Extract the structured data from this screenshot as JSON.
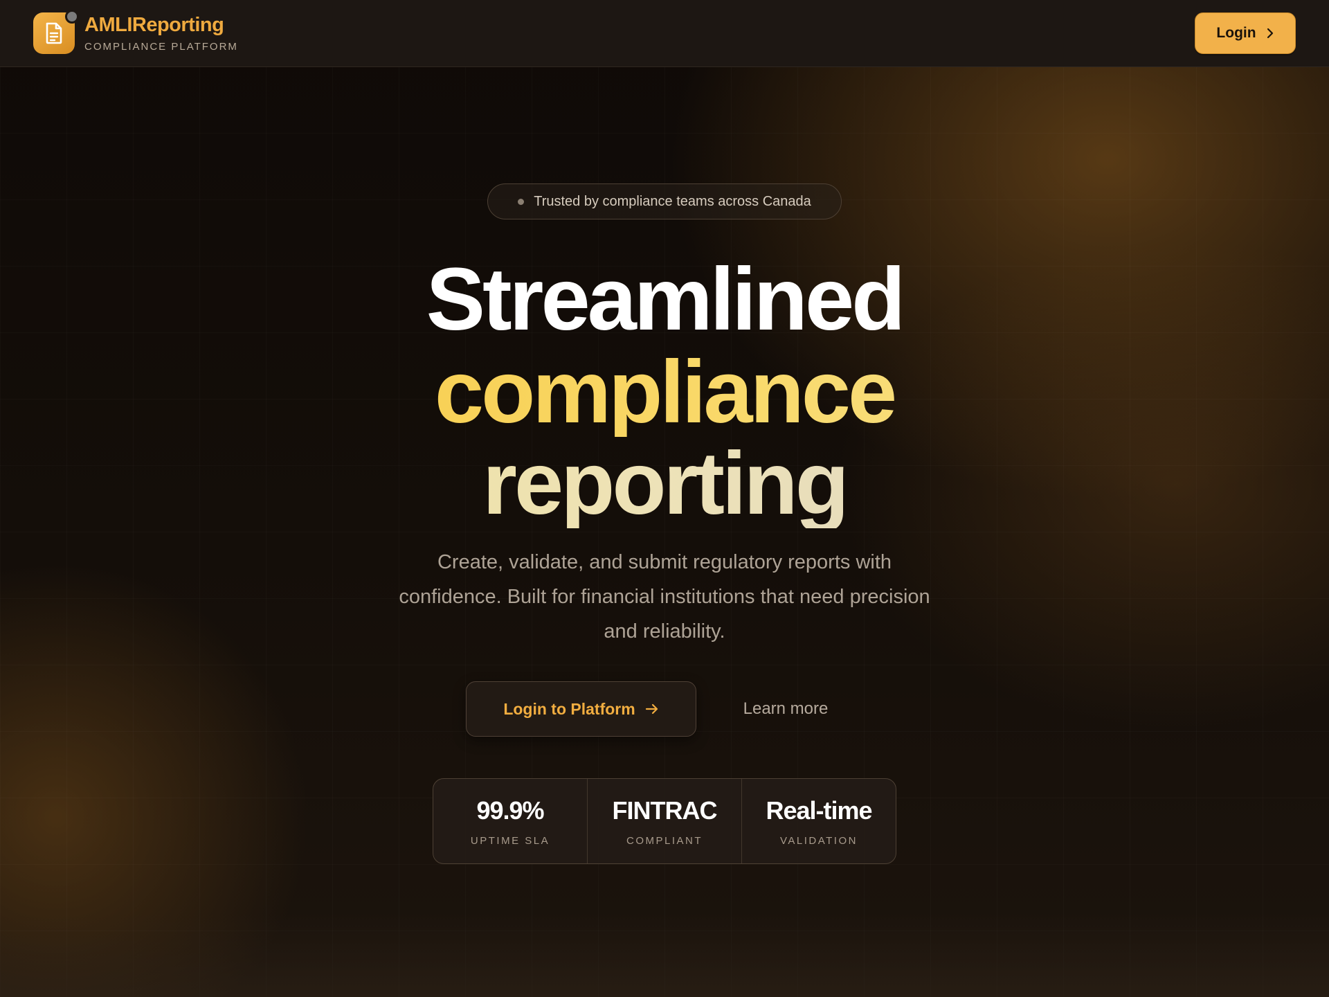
{
  "colors": {
    "accent": "#f2b14a",
    "brand_text": "#efaa3f",
    "background": "#120d09"
  },
  "header": {
    "brand_name": "AMLIReporting",
    "brand_subtitle": "COMPLIANCE PLATFORM",
    "logo_icon": "document-icon",
    "login_label": "Login",
    "login_icon": "chevron-right-icon"
  },
  "hero": {
    "badge_text": "Trusted by compliance teams across Canada",
    "headline_line1": "Streamlined",
    "headline_line2": "compliance",
    "headline_line3": "reporting",
    "description": "Create, validate, and submit regulatory reports with confidence. Built for financial institutions that need precision and reliability.",
    "cta_label": "Login to Platform",
    "cta_icon": "arrow-right-icon",
    "learn_more_label": "Learn more"
  },
  "stats": [
    {
      "value": "99.9%",
      "label": "UPTIME SLA"
    },
    {
      "value": "FINTRAC",
      "label": "COMPLIANT"
    },
    {
      "value": "Real-time",
      "label": "VALIDATION"
    }
  ]
}
